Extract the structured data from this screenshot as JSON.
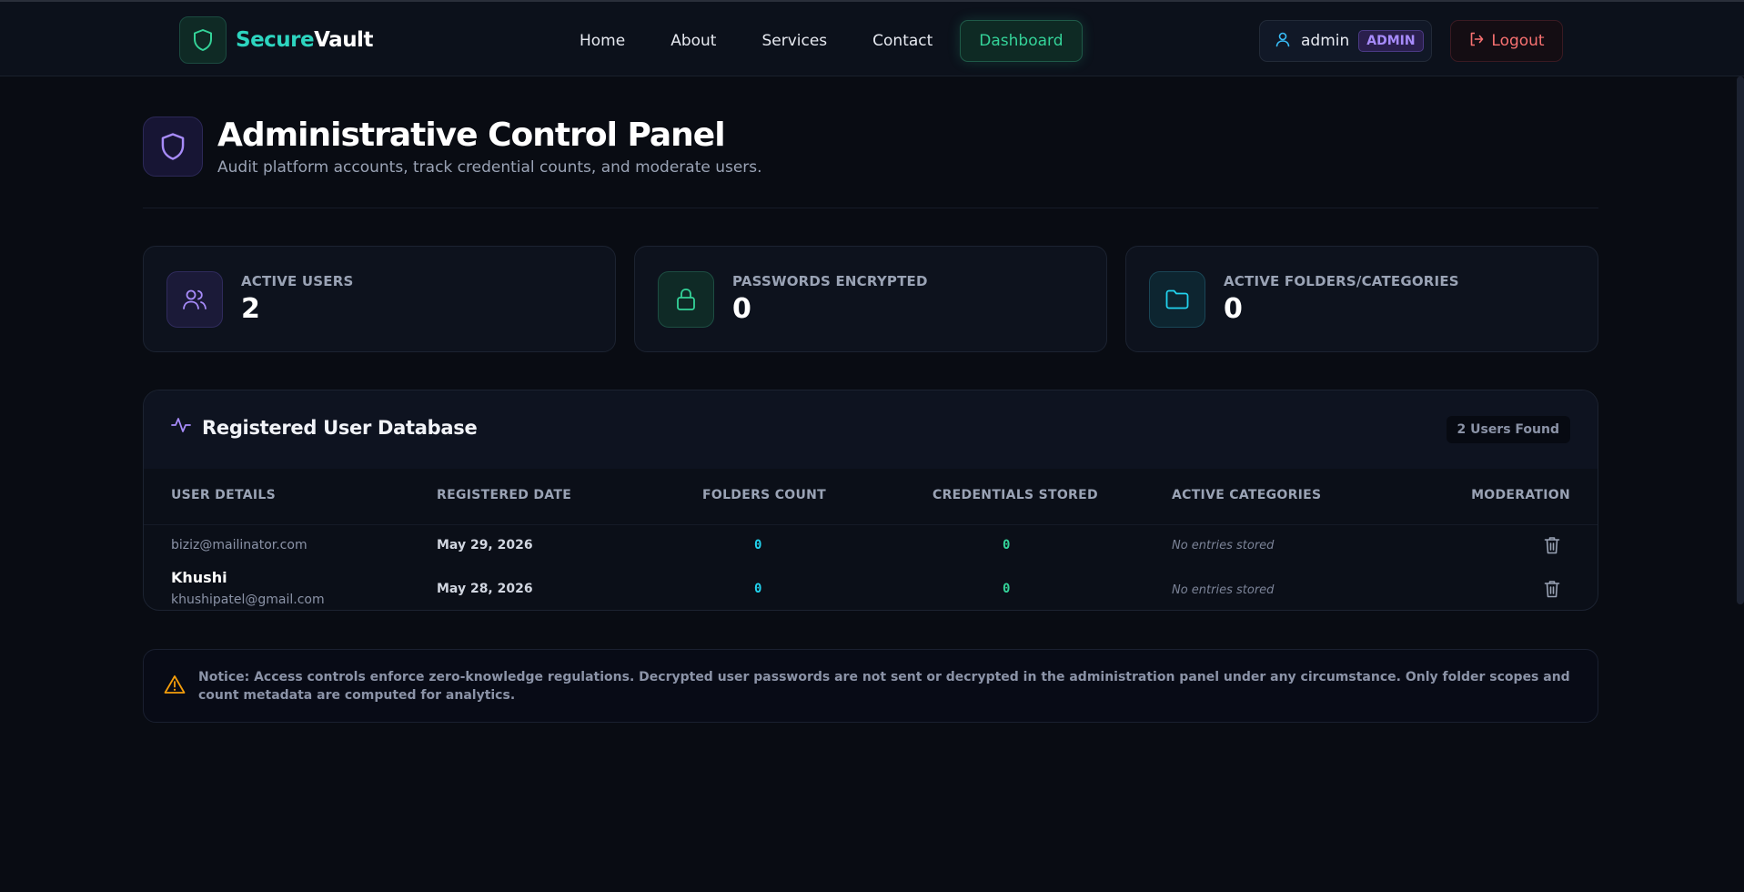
{
  "brand": {
    "name_part1": "Secure",
    "name_part2": "Vault"
  },
  "nav": {
    "links": [
      "Home",
      "About",
      "Services",
      "Contact"
    ],
    "active": "Dashboard"
  },
  "user": {
    "name": "admin",
    "role": "ADMIN",
    "logout_label": "Logout"
  },
  "header": {
    "title": "Administrative Control Panel",
    "subtitle": "Audit platform accounts, track credential counts, and moderate users."
  },
  "stats": [
    {
      "label": "ACTIVE USERS",
      "value": "2",
      "icon": "users-icon",
      "color": "#a78bfa"
    },
    {
      "label": "PASSWORDS ENCRYPTED",
      "value": "0",
      "icon": "lock-icon",
      "color": "#34d399"
    },
    {
      "label": "ACTIVE FOLDERS/CATEGORIES",
      "value": "0",
      "icon": "folder-icon",
      "color": "#22d3ee"
    }
  ],
  "table": {
    "title": "Registered User Database",
    "found_badge": "2 Users Found",
    "columns": [
      "USER DETAILS",
      "REGISTERED DATE",
      "FOLDERS COUNT",
      "CREDENTIALS STORED",
      "ACTIVE CATEGORIES",
      "MODERATION"
    ],
    "rows": [
      {
        "name": "",
        "email": "biziz@mailinator.com",
        "date": "May 29, 2026",
        "folders": "0",
        "credentials": "0",
        "categories": "No entries stored"
      },
      {
        "name": "Khushi",
        "email": "khushipatel@gmail.com",
        "date": "May 28, 2026",
        "folders": "0",
        "credentials": "0",
        "categories": "No entries stored"
      }
    ]
  },
  "notice": {
    "text": "Notice: Access controls enforce zero-knowledge regulations. Decrypted user passwords are not sent or decrypted in the administration panel under any circumstance. Only folder scopes and count metadata are computed for analytics."
  },
  "colors": {
    "accent_teal": "#2dd4bf",
    "accent_green": "#34d399",
    "accent_purple": "#a78bfa",
    "danger": "#f87171",
    "background": "#090c13"
  }
}
